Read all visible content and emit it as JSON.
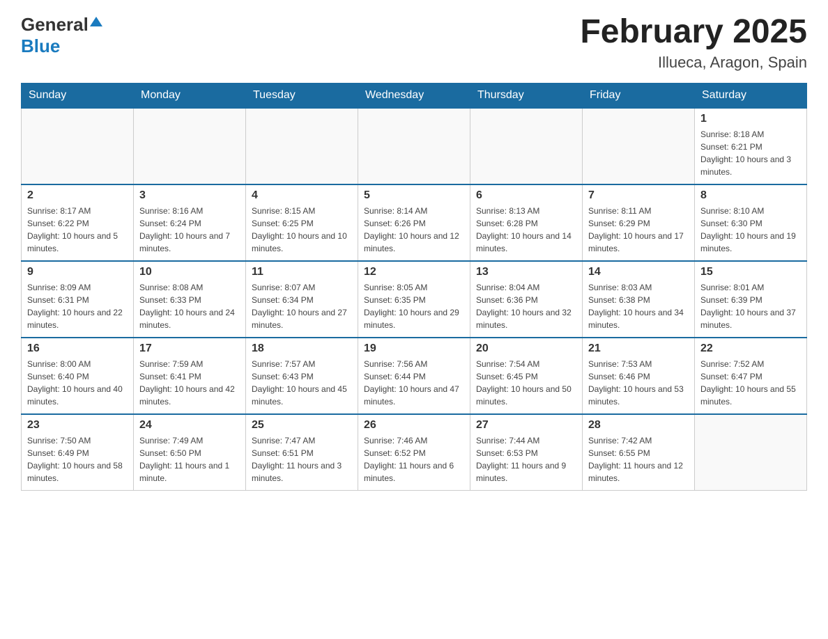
{
  "header": {
    "logo_general": "General",
    "logo_blue": "Blue",
    "month_title": "February 2025",
    "subtitle": "Illueca, Aragon, Spain"
  },
  "days_of_week": [
    "Sunday",
    "Monday",
    "Tuesday",
    "Wednesday",
    "Thursday",
    "Friday",
    "Saturday"
  ],
  "weeks": [
    {
      "days": [
        {
          "date": "",
          "info": ""
        },
        {
          "date": "",
          "info": ""
        },
        {
          "date": "",
          "info": ""
        },
        {
          "date": "",
          "info": ""
        },
        {
          "date": "",
          "info": ""
        },
        {
          "date": "",
          "info": ""
        },
        {
          "date": "1",
          "sunrise": "8:18 AM",
          "sunset": "6:21 PM",
          "daylight": "10 hours and 3 minutes."
        }
      ]
    },
    {
      "days": [
        {
          "date": "2",
          "sunrise": "8:17 AM",
          "sunset": "6:22 PM",
          "daylight": "10 hours and 5 minutes."
        },
        {
          "date": "3",
          "sunrise": "8:16 AM",
          "sunset": "6:24 PM",
          "daylight": "10 hours and 7 minutes."
        },
        {
          "date": "4",
          "sunrise": "8:15 AM",
          "sunset": "6:25 PM",
          "daylight": "10 hours and 10 minutes."
        },
        {
          "date": "5",
          "sunrise": "8:14 AM",
          "sunset": "6:26 PM",
          "daylight": "10 hours and 12 minutes."
        },
        {
          "date": "6",
          "sunrise": "8:13 AM",
          "sunset": "6:28 PM",
          "daylight": "10 hours and 14 minutes."
        },
        {
          "date": "7",
          "sunrise": "8:11 AM",
          "sunset": "6:29 PM",
          "daylight": "10 hours and 17 minutes."
        },
        {
          "date": "8",
          "sunrise": "8:10 AM",
          "sunset": "6:30 PM",
          "daylight": "10 hours and 19 minutes."
        }
      ]
    },
    {
      "days": [
        {
          "date": "9",
          "sunrise": "8:09 AM",
          "sunset": "6:31 PM",
          "daylight": "10 hours and 22 minutes."
        },
        {
          "date": "10",
          "sunrise": "8:08 AM",
          "sunset": "6:33 PM",
          "daylight": "10 hours and 24 minutes."
        },
        {
          "date": "11",
          "sunrise": "8:07 AM",
          "sunset": "6:34 PM",
          "daylight": "10 hours and 27 minutes."
        },
        {
          "date": "12",
          "sunrise": "8:05 AM",
          "sunset": "6:35 PM",
          "daylight": "10 hours and 29 minutes."
        },
        {
          "date": "13",
          "sunrise": "8:04 AM",
          "sunset": "6:36 PM",
          "daylight": "10 hours and 32 minutes."
        },
        {
          "date": "14",
          "sunrise": "8:03 AM",
          "sunset": "6:38 PM",
          "daylight": "10 hours and 34 minutes."
        },
        {
          "date": "15",
          "sunrise": "8:01 AM",
          "sunset": "6:39 PM",
          "daylight": "10 hours and 37 minutes."
        }
      ]
    },
    {
      "days": [
        {
          "date": "16",
          "sunrise": "8:00 AM",
          "sunset": "6:40 PM",
          "daylight": "10 hours and 40 minutes."
        },
        {
          "date": "17",
          "sunrise": "7:59 AM",
          "sunset": "6:41 PM",
          "daylight": "10 hours and 42 minutes."
        },
        {
          "date": "18",
          "sunrise": "7:57 AM",
          "sunset": "6:43 PM",
          "daylight": "10 hours and 45 minutes."
        },
        {
          "date": "19",
          "sunrise": "7:56 AM",
          "sunset": "6:44 PM",
          "daylight": "10 hours and 47 minutes."
        },
        {
          "date": "20",
          "sunrise": "7:54 AM",
          "sunset": "6:45 PM",
          "daylight": "10 hours and 50 minutes."
        },
        {
          "date": "21",
          "sunrise": "7:53 AM",
          "sunset": "6:46 PM",
          "daylight": "10 hours and 53 minutes."
        },
        {
          "date": "22",
          "sunrise": "7:52 AM",
          "sunset": "6:47 PM",
          "daylight": "10 hours and 55 minutes."
        }
      ]
    },
    {
      "days": [
        {
          "date": "23",
          "sunrise": "7:50 AM",
          "sunset": "6:49 PM",
          "daylight": "10 hours and 58 minutes."
        },
        {
          "date": "24",
          "sunrise": "7:49 AM",
          "sunset": "6:50 PM",
          "daylight": "11 hours and 1 minute."
        },
        {
          "date": "25",
          "sunrise": "7:47 AM",
          "sunset": "6:51 PM",
          "daylight": "11 hours and 3 minutes."
        },
        {
          "date": "26",
          "sunrise": "7:46 AM",
          "sunset": "6:52 PM",
          "daylight": "11 hours and 6 minutes."
        },
        {
          "date": "27",
          "sunrise": "7:44 AM",
          "sunset": "6:53 PM",
          "daylight": "11 hours and 9 minutes."
        },
        {
          "date": "28",
          "sunrise": "7:42 AM",
          "sunset": "6:55 PM",
          "daylight": "11 hours and 12 minutes."
        },
        {
          "date": "",
          "sunrise": "",
          "sunset": "",
          "daylight": ""
        }
      ]
    }
  ],
  "labels": {
    "sunrise": "Sunrise:",
    "sunset": "Sunset:",
    "daylight": "Daylight:"
  }
}
